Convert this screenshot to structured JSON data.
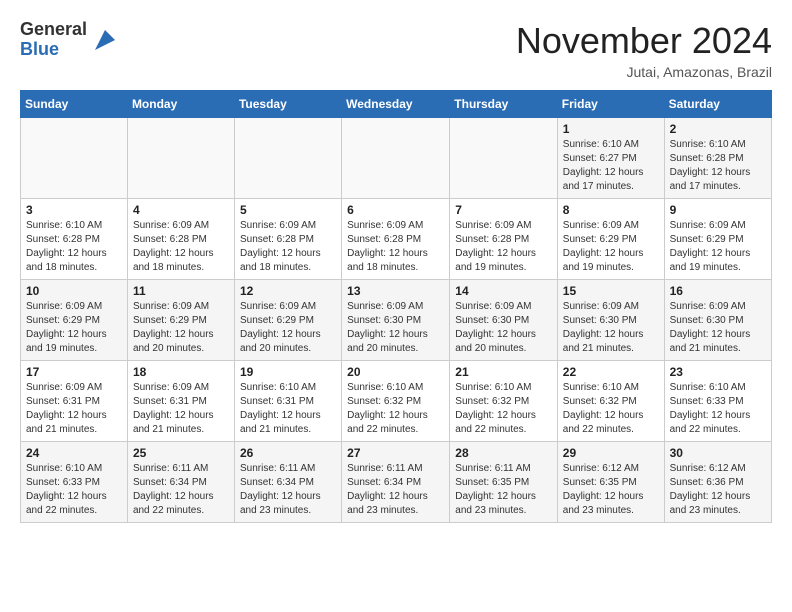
{
  "header": {
    "logo_general": "General",
    "logo_blue": "Blue",
    "month_title": "November 2024",
    "location": "Jutai, Amazonas, Brazil"
  },
  "days_of_week": [
    "Sunday",
    "Monday",
    "Tuesday",
    "Wednesday",
    "Thursday",
    "Friday",
    "Saturday"
  ],
  "weeks": [
    [
      {
        "day": "",
        "info": ""
      },
      {
        "day": "",
        "info": ""
      },
      {
        "day": "",
        "info": ""
      },
      {
        "day": "",
        "info": ""
      },
      {
        "day": "",
        "info": ""
      },
      {
        "day": "1",
        "info": "Sunrise: 6:10 AM\nSunset: 6:27 PM\nDaylight: 12 hours\nand 17 minutes."
      },
      {
        "day": "2",
        "info": "Sunrise: 6:10 AM\nSunset: 6:28 PM\nDaylight: 12 hours\nand 17 minutes."
      }
    ],
    [
      {
        "day": "3",
        "info": "Sunrise: 6:10 AM\nSunset: 6:28 PM\nDaylight: 12 hours\nand 18 minutes."
      },
      {
        "day": "4",
        "info": "Sunrise: 6:09 AM\nSunset: 6:28 PM\nDaylight: 12 hours\nand 18 minutes."
      },
      {
        "day": "5",
        "info": "Sunrise: 6:09 AM\nSunset: 6:28 PM\nDaylight: 12 hours\nand 18 minutes."
      },
      {
        "day": "6",
        "info": "Sunrise: 6:09 AM\nSunset: 6:28 PM\nDaylight: 12 hours\nand 18 minutes."
      },
      {
        "day": "7",
        "info": "Sunrise: 6:09 AM\nSunset: 6:28 PM\nDaylight: 12 hours\nand 19 minutes."
      },
      {
        "day": "8",
        "info": "Sunrise: 6:09 AM\nSunset: 6:29 PM\nDaylight: 12 hours\nand 19 minutes."
      },
      {
        "day": "9",
        "info": "Sunrise: 6:09 AM\nSunset: 6:29 PM\nDaylight: 12 hours\nand 19 minutes."
      }
    ],
    [
      {
        "day": "10",
        "info": "Sunrise: 6:09 AM\nSunset: 6:29 PM\nDaylight: 12 hours\nand 19 minutes."
      },
      {
        "day": "11",
        "info": "Sunrise: 6:09 AM\nSunset: 6:29 PM\nDaylight: 12 hours\nand 20 minutes."
      },
      {
        "day": "12",
        "info": "Sunrise: 6:09 AM\nSunset: 6:29 PM\nDaylight: 12 hours\nand 20 minutes."
      },
      {
        "day": "13",
        "info": "Sunrise: 6:09 AM\nSunset: 6:30 PM\nDaylight: 12 hours\nand 20 minutes."
      },
      {
        "day": "14",
        "info": "Sunrise: 6:09 AM\nSunset: 6:30 PM\nDaylight: 12 hours\nand 20 minutes."
      },
      {
        "day": "15",
        "info": "Sunrise: 6:09 AM\nSunset: 6:30 PM\nDaylight: 12 hours\nand 21 minutes."
      },
      {
        "day": "16",
        "info": "Sunrise: 6:09 AM\nSunset: 6:30 PM\nDaylight: 12 hours\nand 21 minutes."
      }
    ],
    [
      {
        "day": "17",
        "info": "Sunrise: 6:09 AM\nSunset: 6:31 PM\nDaylight: 12 hours\nand 21 minutes."
      },
      {
        "day": "18",
        "info": "Sunrise: 6:09 AM\nSunset: 6:31 PM\nDaylight: 12 hours\nand 21 minutes."
      },
      {
        "day": "19",
        "info": "Sunrise: 6:10 AM\nSunset: 6:31 PM\nDaylight: 12 hours\nand 21 minutes."
      },
      {
        "day": "20",
        "info": "Sunrise: 6:10 AM\nSunset: 6:32 PM\nDaylight: 12 hours\nand 22 minutes."
      },
      {
        "day": "21",
        "info": "Sunrise: 6:10 AM\nSunset: 6:32 PM\nDaylight: 12 hours\nand 22 minutes."
      },
      {
        "day": "22",
        "info": "Sunrise: 6:10 AM\nSunset: 6:32 PM\nDaylight: 12 hours\nand 22 minutes."
      },
      {
        "day": "23",
        "info": "Sunrise: 6:10 AM\nSunset: 6:33 PM\nDaylight: 12 hours\nand 22 minutes."
      }
    ],
    [
      {
        "day": "24",
        "info": "Sunrise: 6:10 AM\nSunset: 6:33 PM\nDaylight: 12 hours\nand 22 minutes."
      },
      {
        "day": "25",
        "info": "Sunrise: 6:11 AM\nSunset: 6:34 PM\nDaylight: 12 hours\nand 22 minutes."
      },
      {
        "day": "26",
        "info": "Sunrise: 6:11 AM\nSunset: 6:34 PM\nDaylight: 12 hours\nand 23 minutes."
      },
      {
        "day": "27",
        "info": "Sunrise: 6:11 AM\nSunset: 6:34 PM\nDaylight: 12 hours\nand 23 minutes."
      },
      {
        "day": "28",
        "info": "Sunrise: 6:11 AM\nSunset: 6:35 PM\nDaylight: 12 hours\nand 23 minutes."
      },
      {
        "day": "29",
        "info": "Sunrise: 6:12 AM\nSunset: 6:35 PM\nDaylight: 12 hours\nand 23 minutes."
      },
      {
        "day": "30",
        "info": "Sunrise: 6:12 AM\nSunset: 6:36 PM\nDaylight: 12 hours\nand 23 minutes."
      }
    ]
  ]
}
